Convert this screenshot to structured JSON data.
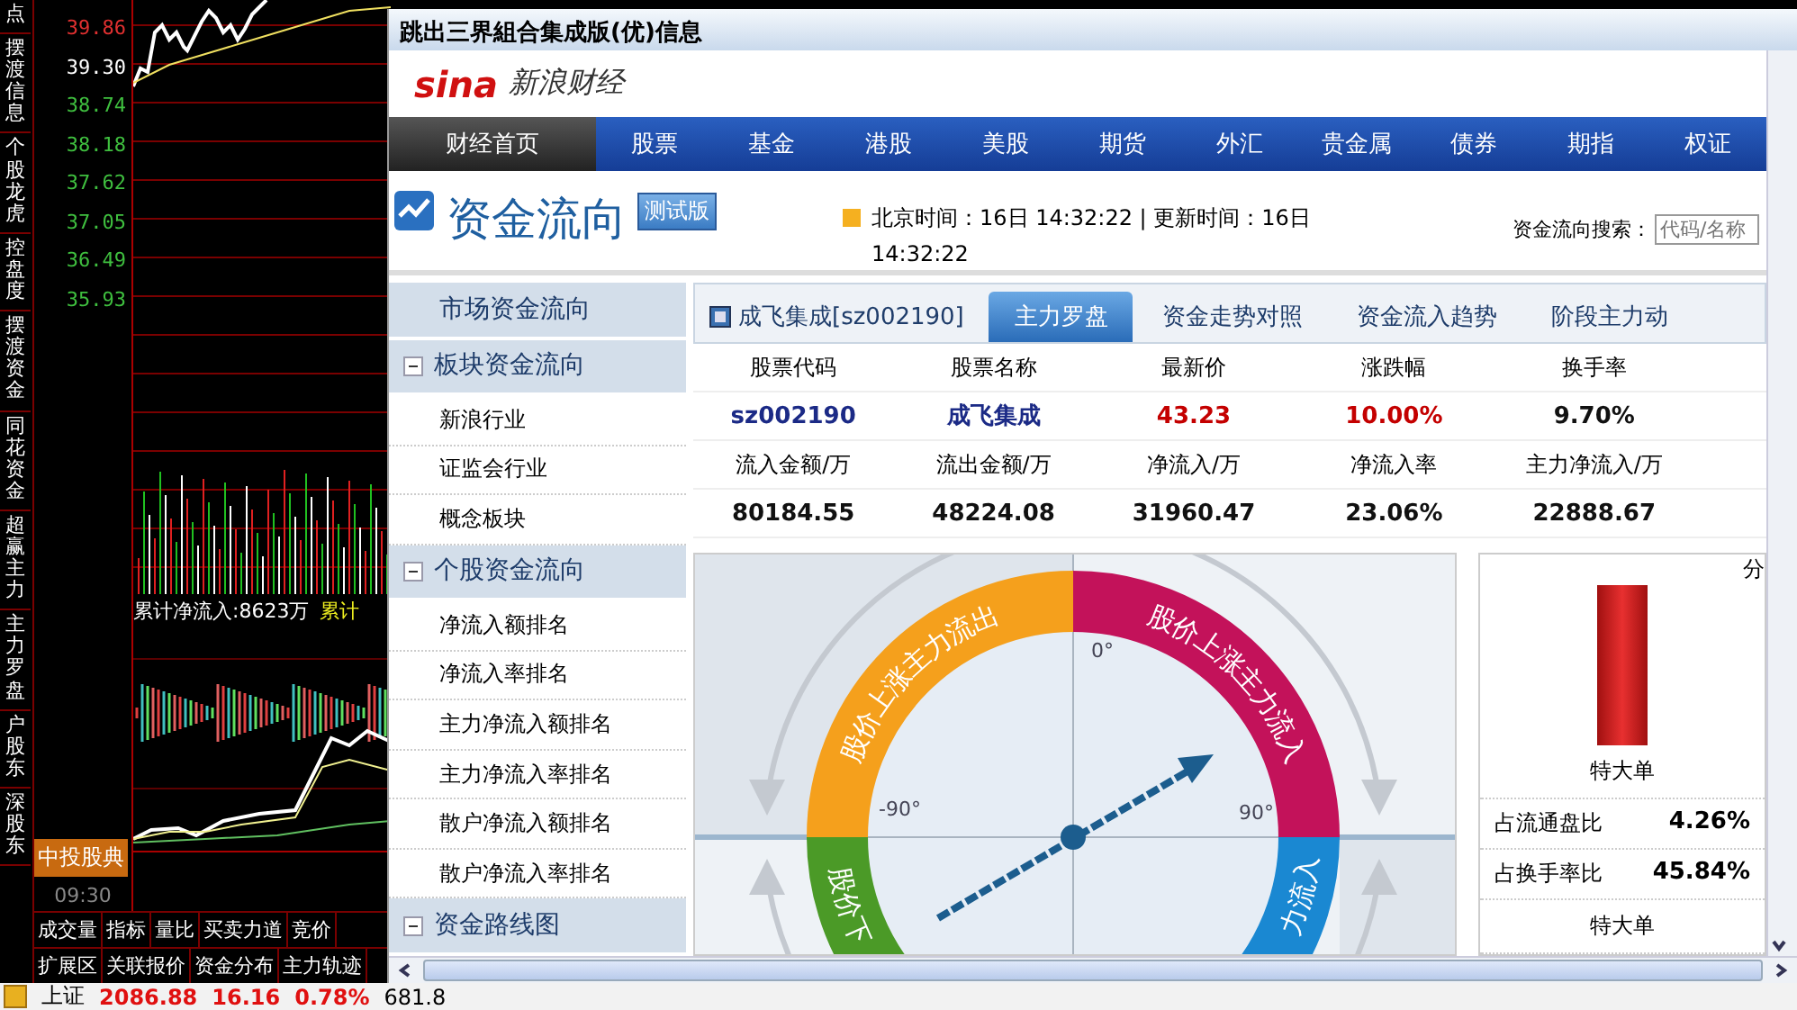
{
  "left_panel": {
    "side_tabs": [
      {
        "label": "点"
      },
      {
        "label": "摆渡信息"
      },
      {
        "label": "个股龙虎"
      },
      {
        "label": "控盘度"
      },
      {
        "label": "摆渡资金"
      },
      {
        "label": "同花资金"
      },
      {
        "label": "超赢主力"
      },
      {
        "label": "主力罗盘"
      },
      {
        "label": "户股东"
      },
      {
        "label": "深股东"
      }
    ],
    "price_axis": [
      {
        "text": "39.86",
        "kind": "up"
      },
      {
        "text": "39.30",
        "kind": "flat"
      },
      {
        "text": "38.74",
        "kind": "down"
      },
      {
        "text": "38.18",
        "kind": "down"
      },
      {
        "text": "37.62",
        "kind": "down"
      },
      {
        "text": "37.05",
        "kind": "down"
      },
      {
        "text": "36.49",
        "kind": "down"
      },
      {
        "text": "35.93",
        "kind": "down"
      }
    ],
    "flow_labels": [
      {
        "text": "累计净流入:8623万",
        "kind": "total"
      },
      {
        "text": "累计",
        "kind": "main"
      }
    ],
    "badge": "中投股典",
    "time": "09:30",
    "bottom_tabs": [
      [
        {
          "label": "成交量"
        },
        {
          "label": "指标"
        },
        {
          "label": "量比"
        },
        {
          "label": "买卖力道"
        },
        {
          "label": "竞价"
        }
      ],
      [
        {
          "label": "扩展区"
        },
        {
          "label": "关联报价"
        },
        {
          "label": "资金分布"
        },
        {
          "label": "主力轨迹"
        }
      ]
    ]
  },
  "window": {
    "title": "跳出三界組合集成版(优)信息",
    "logo": "sina",
    "brand": "新浪财经",
    "nav": [
      {
        "label": "财经首页",
        "selected": true
      },
      {
        "label": "股票",
        "selected": false
      },
      {
        "label": "基金",
        "selected": false
      },
      {
        "label": "港股",
        "selected": false
      },
      {
        "label": "美股",
        "selected": false
      },
      {
        "label": "期货",
        "selected": false
      },
      {
        "label": "外汇",
        "selected": false
      },
      {
        "label": "贵金属",
        "selected": false
      },
      {
        "label": "债券",
        "selected": false
      },
      {
        "label": "期指",
        "selected": false
      },
      {
        "label": "权证",
        "selected": false
      }
    ],
    "page_title": "资金流向",
    "beta_badge": "测试版",
    "time_info": "北京时间：16日 14:32:22 | 更新时间：16日 14:32:22",
    "search": {
      "label": "资金流向搜索：",
      "placeholder": "代码/名称"
    },
    "sidebar": [
      {
        "label": "市场资金流向",
        "kind": "link"
      },
      {
        "label": "板块资金流向",
        "kind": "group",
        "expanded": true,
        "children": [
          {
            "label": "新浪行业"
          },
          {
            "label": "证监会行业"
          },
          {
            "label": "概念板块"
          }
        ]
      },
      {
        "label": "个股资金流向",
        "kind": "group",
        "expanded": true,
        "children": [
          {
            "label": "净流入额排名"
          },
          {
            "label": "净流入率排名"
          },
          {
            "label": "主力净流入额排名"
          },
          {
            "label": "主力净流入率排名"
          },
          {
            "label": "散户净流入额排名"
          },
          {
            "label": "散户净流入率排名"
          }
        ]
      },
      {
        "label": "资金路线图",
        "kind": "group",
        "expanded": true
      }
    ],
    "stock_label": "成飞集成[sz002190]",
    "tabs": [
      {
        "label": "主力罗盘",
        "selected": true
      },
      {
        "label": "资金走势对照",
        "selected": false
      },
      {
        "label": "资金流入趋势",
        "selected": false
      },
      {
        "label": "阶段主力动",
        "selected": false
      }
    ],
    "table": [
      {
        "kind": "header",
        "cells": [
          "股票代码",
          "股票名称",
          "最新价",
          "涨跌幅",
          "换手率"
        ]
      },
      {
        "kind": "value",
        "cells": [
          {
            "text": "sz002190",
            "kind": "code"
          },
          {
            "text": "成飞集成",
            "kind": "code"
          },
          {
            "text": "43.23",
            "kind": "up"
          },
          {
            "text": "10.00%",
            "kind": "up"
          },
          {
            "text": "9.70%",
            "kind": "plain"
          }
        ]
      },
      {
        "kind": "header",
        "cells": [
          "流入金额/万",
          "流出金额/万",
          "净流入/万",
          "净流入率",
          "主力净流入/万"
        ]
      },
      {
        "kind": "value",
        "cells": [
          {
            "text": "80184.55",
            "kind": "plain"
          },
          {
            "text": "48224.08",
            "kind": "plain"
          },
          {
            "text": "31960.47",
            "kind": "plain"
          },
          {
            "text": "23.06%",
            "kind": "plain"
          },
          {
            "text": "22888.67",
            "kind": "plain"
          }
        ]
      }
    ],
    "compass": {
      "quadrants": [
        {
          "label": "股价上涨主力流出",
          "color": "#f5a01c"
        },
        {
          "label": "股价上涨主力流入",
          "color": "#c3125a"
        },
        {
          "label": "股价下",
          "color": "#4b9a27"
        },
        {
          "label": "力流入",
          "color": "#1a88d2"
        }
      ],
      "angles": [
        "0°",
        "-90°",
        "90°"
      ]
    },
    "order_panel": {
      "heading": "分",
      "bar_label": "特大单",
      "stats": [
        {
          "label": "占流通盘比",
          "value": "4.26%"
        },
        {
          "label": "占换手率比",
          "value": "45.84%"
        }
      ],
      "footer_label": "特大单"
    }
  },
  "status_bar": {
    "index_name": "上证",
    "value": "2086.88",
    "change": "16.16",
    "change_pct": "0.78%",
    "volume": "681.8"
  }
}
